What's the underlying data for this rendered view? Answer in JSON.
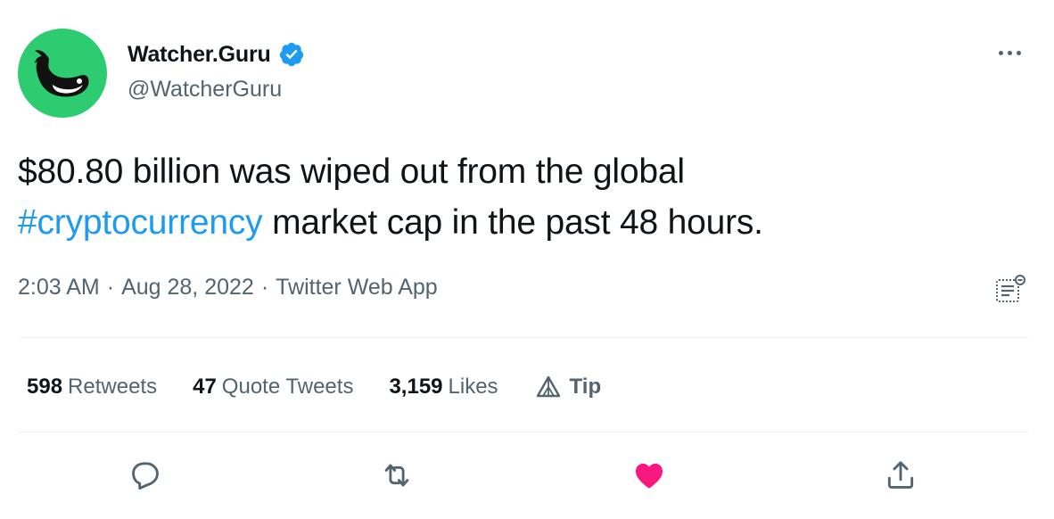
{
  "account": {
    "display_name": "Watcher.Guru",
    "handle": "@WatcherGuru",
    "verified": true,
    "avatar_icon": "whale-logo-icon",
    "avatar_color": "#2ecc71"
  },
  "tweet": {
    "text_before": "$80.80 billion was wiped out from the global",
    "hashtag": "#cryptocurrency",
    "text_after": " market cap in the past 48 hours."
  },
  "meta": {
    "time": "2:03 AM",
    "separator": "·",
    "date": "Aug 28, 2022",
    "source": "Twitter Web App"
  },
  "stats": {
    "retweets_count": "598",
    "retweets_label": "Retweets",
    "quotes_count": "47",
    "quotes_label": "Quote Tweets",
    "likes_count": "3,159",
    "likes_label": "Likes",
    "tip_label": "Tip"
  },
  "actions": {
    "reply_icon": "reply-icon",
    "retweet_icon": "retweet-icon",
    "like_icon": "heart-icon",
    "share_icon": "share-icon",
    "liked": true,
    "like_color": "#f91880"
  },
  "colors": {
    "accent": "#1d9bf0",
    "secondary_text": "#536471",
    "primary_text": "#0f1419"
  }
}
